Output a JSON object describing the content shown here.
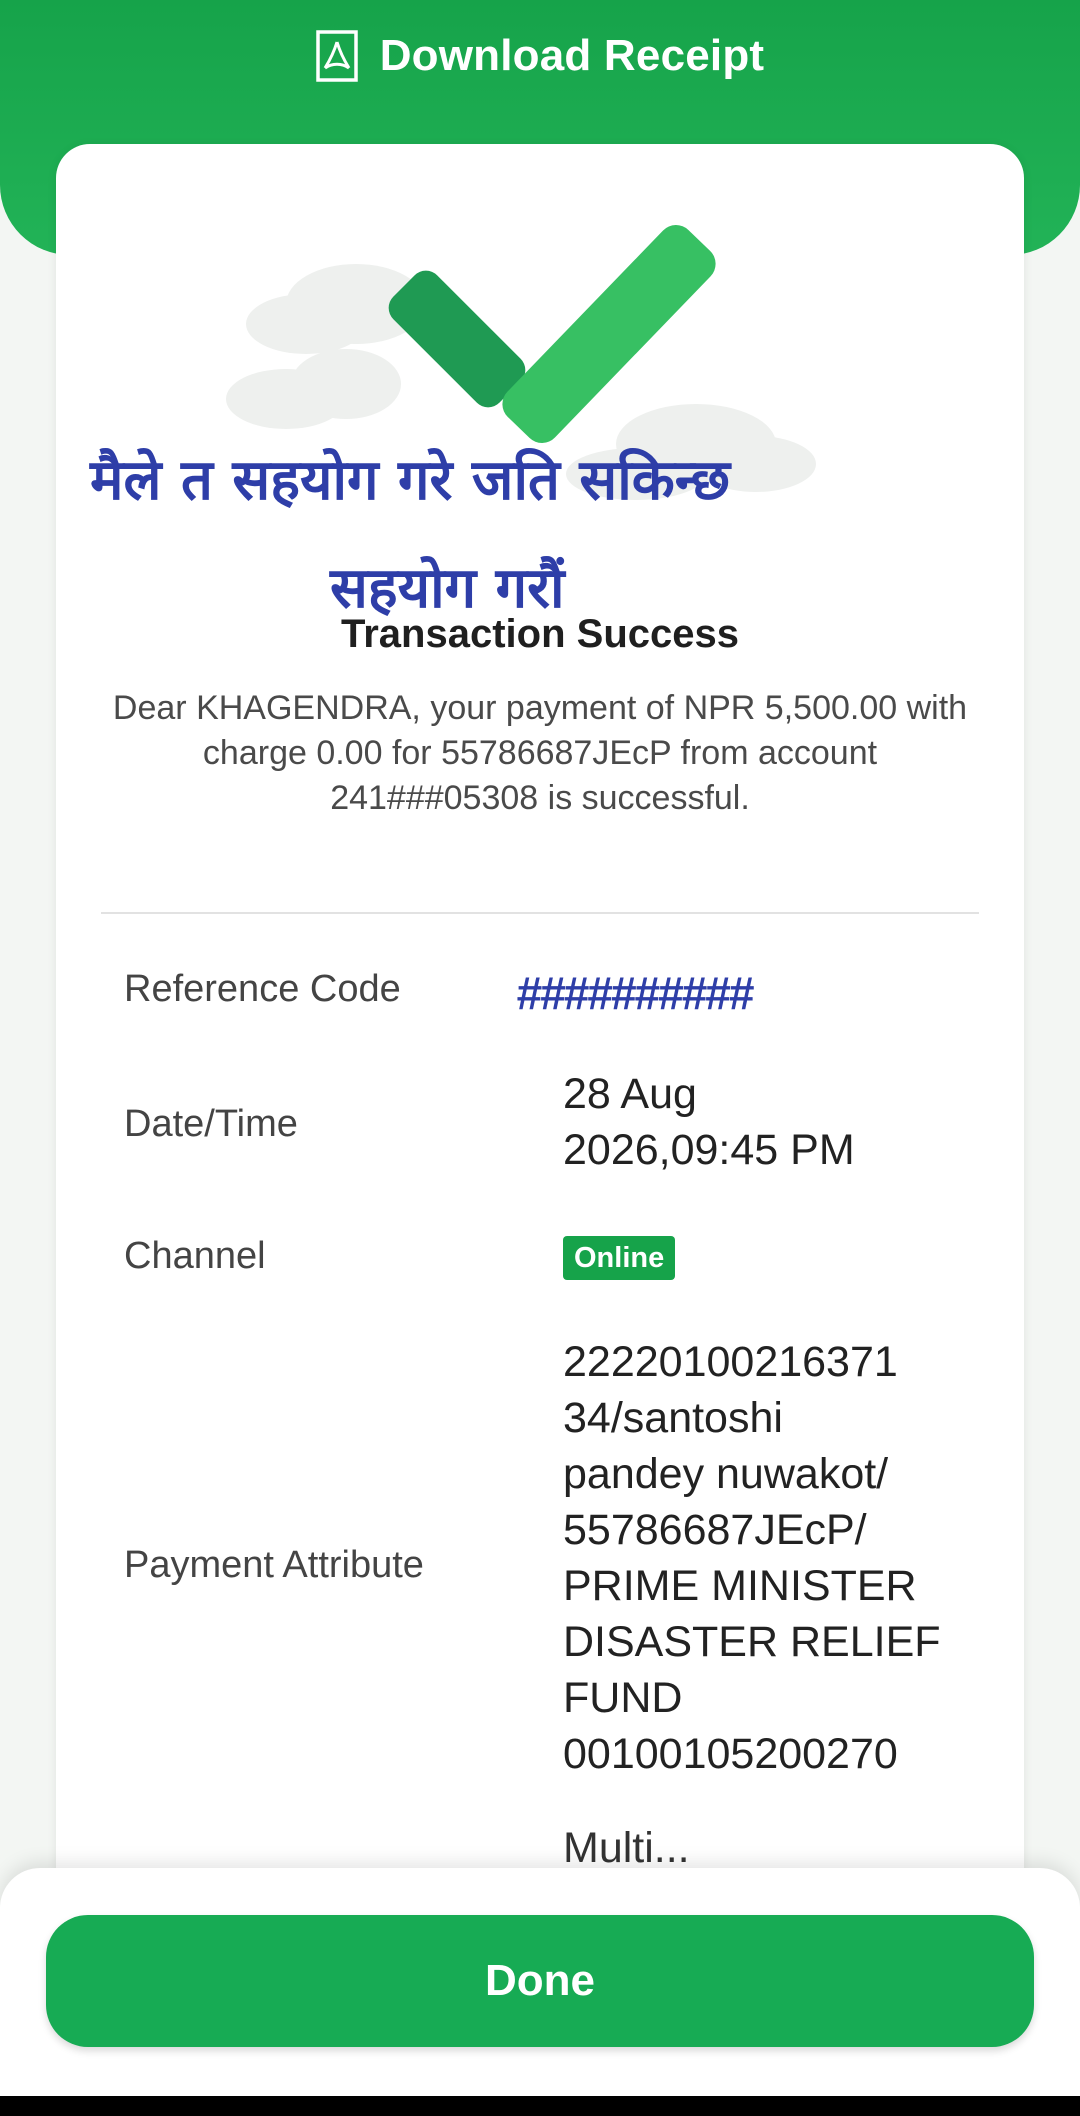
{
  "header": {
    "download_label": "Download Receipt",
    "icon": "pdf-document-icon"
  },
  "overlay_text": {
    "line1": "मैले त सहयोग गरे जति सकिन्छ",
    "line2": "सहयोग गरौं"
  },
  "status": {
    "icon": "success-checkmark-icon",
    "title": "Transaction Success",
    "message": "Dear KHAGENDRA, your payment of NPR 5,500.00 with charge 0.00 for 55786687JEcP from account 241###05308 is successful."
  },
  "details": {
    "reference_label": "Reference Code",
    "reference_value": "##########",
    "datetime_label": "Date/Time",
    "datetime_value": "28 Aug\n2026,09:45 PM",
    "channel_label": "Channel",
    "channel_value": "Online",
    "attribute_label": "Payment Attribute",
    "attribute_value": "22220100216371\n34/santoshi\npandey nuwakot/\n55786687JEcP/\nPRIME MINISTER\nDISASTER RELIEF\nFUND\n00100105200270",
    "next_value_partial": "Multi..."
  },
  "footer": {
    "done_label": "Done"
  },
  "colors": {
    "brand_green": "#16a34a",
    "overlay_blue": "#2e3ea8"
  }
}
